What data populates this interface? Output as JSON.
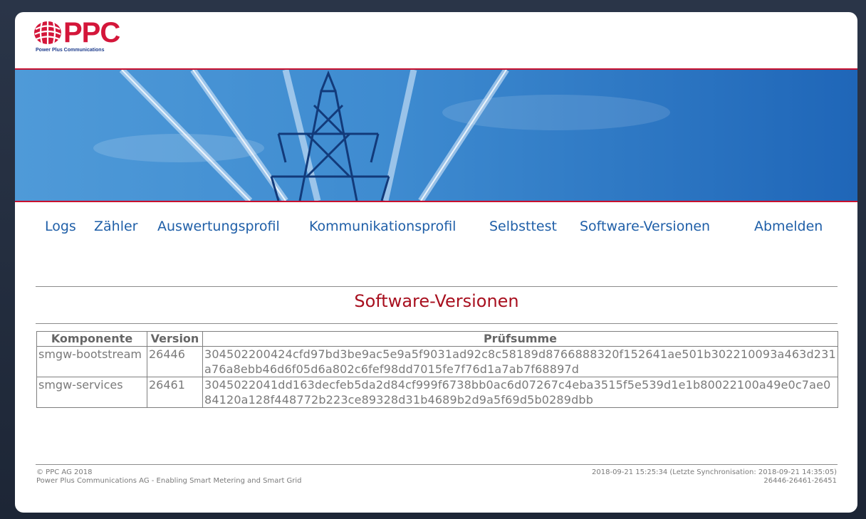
{
  "brand": {
    "logo_text": "PPC",
    "logo_subtitle": "Power Plus Communications",
    "colors": {
      "red": "#c8102e",
      "blue": "#1f5fa8"
    }
  },
  "nav": {
    "items": [
      {
        "label": "Logs"
      },
      {
        "label": "Zähler"
      },
      {
        "label": "Auswertungsprofil"
      },
      {
        "label": "Kommunikationsprofil"
      },
      {
        "label": "Selbsttest"
      },
      {
        "label": "Software-Versionen"
      },
      {
        "label": "Abmelden"
      }
    ]
  },
  "main": {
    "title": "Software-Versionen",
    "table": {
      "headers": [
        "Komponente",
        "Version",
        "Prüfsumme"
      ],
      "rows": [
        {
          "component": "smgw-bootstream",
          "version": "26446",
          "checksum": "304502200424cfd97bd3be9ac5e9a5f9031ad92c8c58189d8766888320f152641ae501b302210093a463d231a76a8ebb46d6f05d6a802c6fef98dd7015fe7f76d1a7ab7f68897d"
        },
        {
          "component": "smgw-services",
          "version": "26461",
          "checksum": "3045022041dd163decfeb5da2d84cf999f6738bb0ac6d07267c4eba3515f5e539d1e1b80022100a49e0c7ae084120a128f448772b223ce89328d31b4689b2d9a5f69d5b0289dbb"
        }
      ]
    }
  },
  "footer": {
    "copyright": "© PPC AG 2018",
    "tagline": "Power Plus Communications AG - Enabling Smart Metering and Smart Grid",
    "timestamp": "2018-09-21 15:25:34 (Letzte Synchronisation: 2018-09-21 14:35:05)",
    "versions": "26446-26461-26451"
  }
}
